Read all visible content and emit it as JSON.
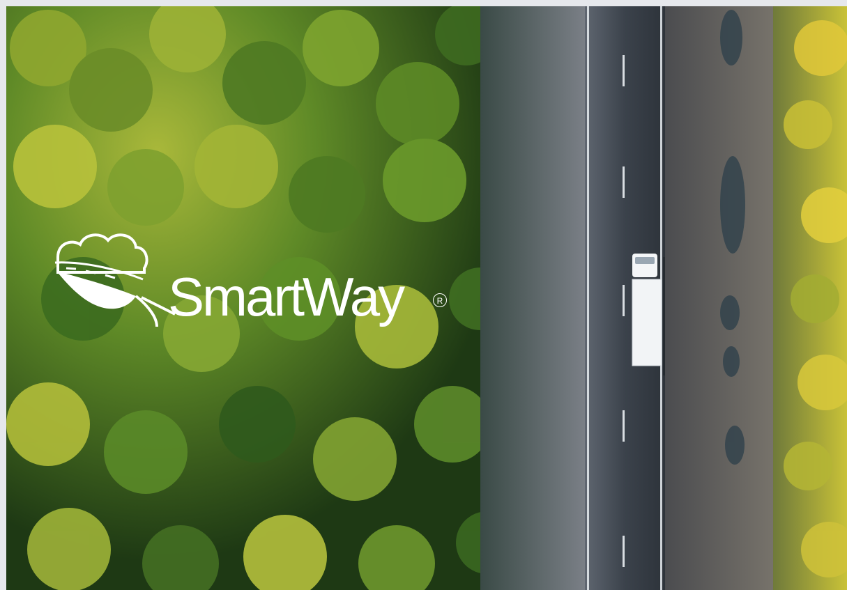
{
  "image": {
    "subject": "aerial-forest-road-truck"
  },
  "logo": {
    "wordmark": "SmartWay",
    "registered_mark": "R",
    "color": "#ffffff"
  },
  "colors": {
    "forest_dark": "#1f3a16",
    "forest_mid": "#4a7a26",
    "forest_light": "#b6c43a",
    "asphalt": "#3f464f",
    "gravel": "#6b6f73",
    "lane_marking": "#e9eef2",
    "truck_trailer": "#f2f4f6"
  }
}
